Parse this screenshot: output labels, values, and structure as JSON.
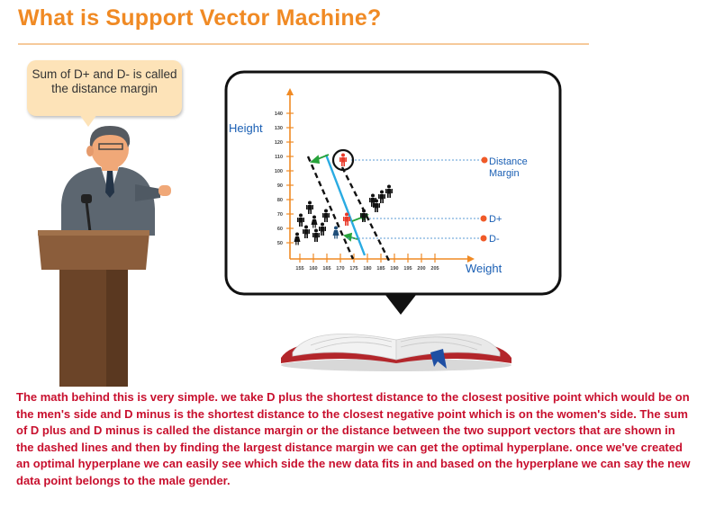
{
  "page": {
    "title": "What is Support Vector Machine?",
    "callout": "Sum of D+ and D- is called the distance margin",
    "description": "The math behind this is very simple. we take D plus the shortest distance to the closest positive point which would be on the men's side and D minus is the shortest distance to the closest negative point which is on the women's side. The sum of D plus and D minus is called the distance margin or the distance between the two support vectors that are shown in the dashed lines and then by finding the largest distance margin we can get the optimal hyperplane. once we've created an optimal hyperplane we can easily see which side the new data fits in and based on the hyperplane we can say the new data point belongs to the male gender."
  },
  "chart": {
    "y_axis_label": "Height",
    "x_axis_label": "Weight",
    "y_ticks": [
      "140",
      "130",
      "120",
      "110",
      "100",
      "90",
      "80",
      "70",
      "60",
      "50"
    ],
    "x_ticks": [
      "155",
      "160",
      "165",
      "170",
      "175",
      "180",
      "185",
      "190",
      "195",
      "200",
      "205"
    ],
    "annotations": {
      "distance_margin": [
        "Distance",
        "Margin"
      ],
      "d_plus": "D+",
      "d_minus": "D-"
    },
    "colors": {
      "axis": "#f08a24",
      "hyperplane": "#29abe2",
      "margin_arrow": "#27a33a",
      "annotation_dot": "#f05a28",
      "axis_label": "#1a5fb4",
      "male_figure": "#111111",
      "female_figure": "#1f4e79",
      "new_point": "#e83a2a"
    }
  }
}
